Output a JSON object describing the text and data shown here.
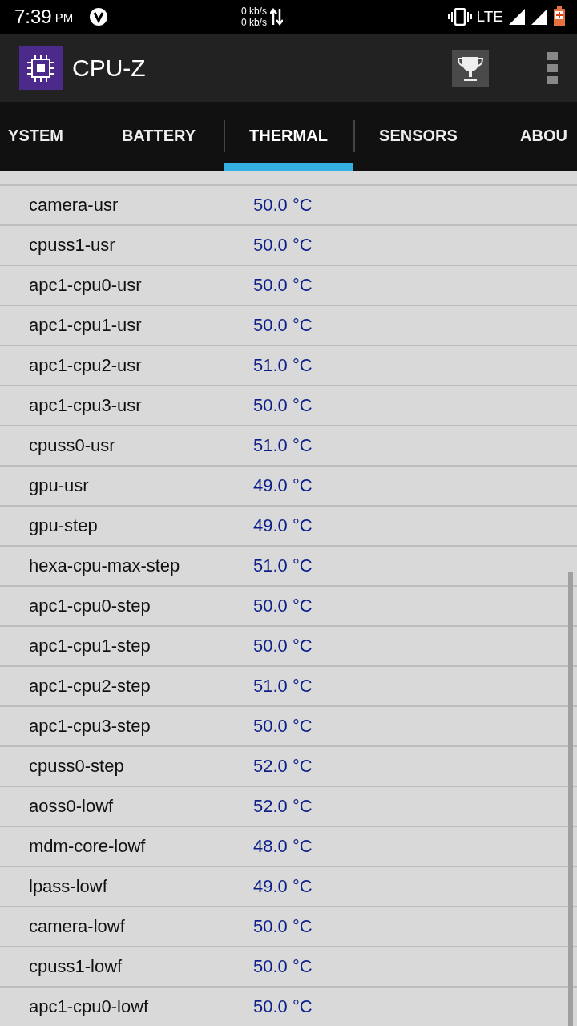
{
  "status_bar": {
    "time": "7:39",
    "ampm": "PM",
    "net_up": "0 kb/s",
    "net_down": "0 kb/s",
    "network": "LTE"
  },
  "app_bar": {
    "title": "CPU-Z"
  },
  "tabs": [
    {
      "label": "YSTEM",
      "selected": false
    },
    {
      "label": "BATTERY",
      "selected": false
    },
    {
      "label": "THERMAL",
      "selected": true
    },
    {
      "label": "SENSORS",
      "selected": false
    },
    {
      "label": "ABOU",
      "selected": false
    }
  ],
  "sensors": [
    {
      "name": "camera-usr",
      "value": "50.0 °C"
    },
    {
      "name": "cpuss1-usr",
      "value": "50.0 °C"
    },
    {
      "name": "apc1-cpu0-usr",
      "value": "50.0 °C"
    },
    {
      "name": "apc1-cpu1-usr",
      "value": "50.0 °C"
    },
    {
      "name": "apc1-cpu2-usr",
      "value": "51.0 °C"
    },
    {
      "name": "apc1-cpu3-usr",
      "value": "50.0 °C"
    },
    {
      "name": "cpuss0-usr",
      "value": "51.0 °C"
    },
    {
      "name": "gpu-usr",
      "value": "49.0 °C"
    },
    {
      "name": "gpu-step",
      "value": "49.0 °C"
    },
    {
      "name": "hexa-cpu-max-step",
      "value": "51.0 °C"
    },
    {
      "name": "apc1-cpu0-step",
      "value": "50.0 °C"
    },
    {
      "name": "apc1-cpu1-step",
      "value": "50.0 °C"
    },
    {
      "name": "apc1-cpu2-step",
      "value": "51.0 °C"
    },
    {
      "name": "apc1-cpu3-step",
      "value": "50.0 °C"
    },
    {
      "name": "cpuss0-step",
      "value": "52.0 °C"
    },
    {
      "name": "aoss0-lowf",
      "value": "52.0 °C"
    },
    {
      "name": "mdm-core-lowf",
      "value": "48.0 °C"
    },
    {
      "name": "lpass-lowf",
      "value": "49.0 °C"
    },
    {
      "name": "camera-lowf",
      "value": "50.0 °C"
    },
    {
      "name": "cpuss1-lowf",
      "value": "50.0 °C"
    },
    {
      "name": "apc1-cpu0-lowf",
      "value": "50.0 °C"
    }
  ]
}
